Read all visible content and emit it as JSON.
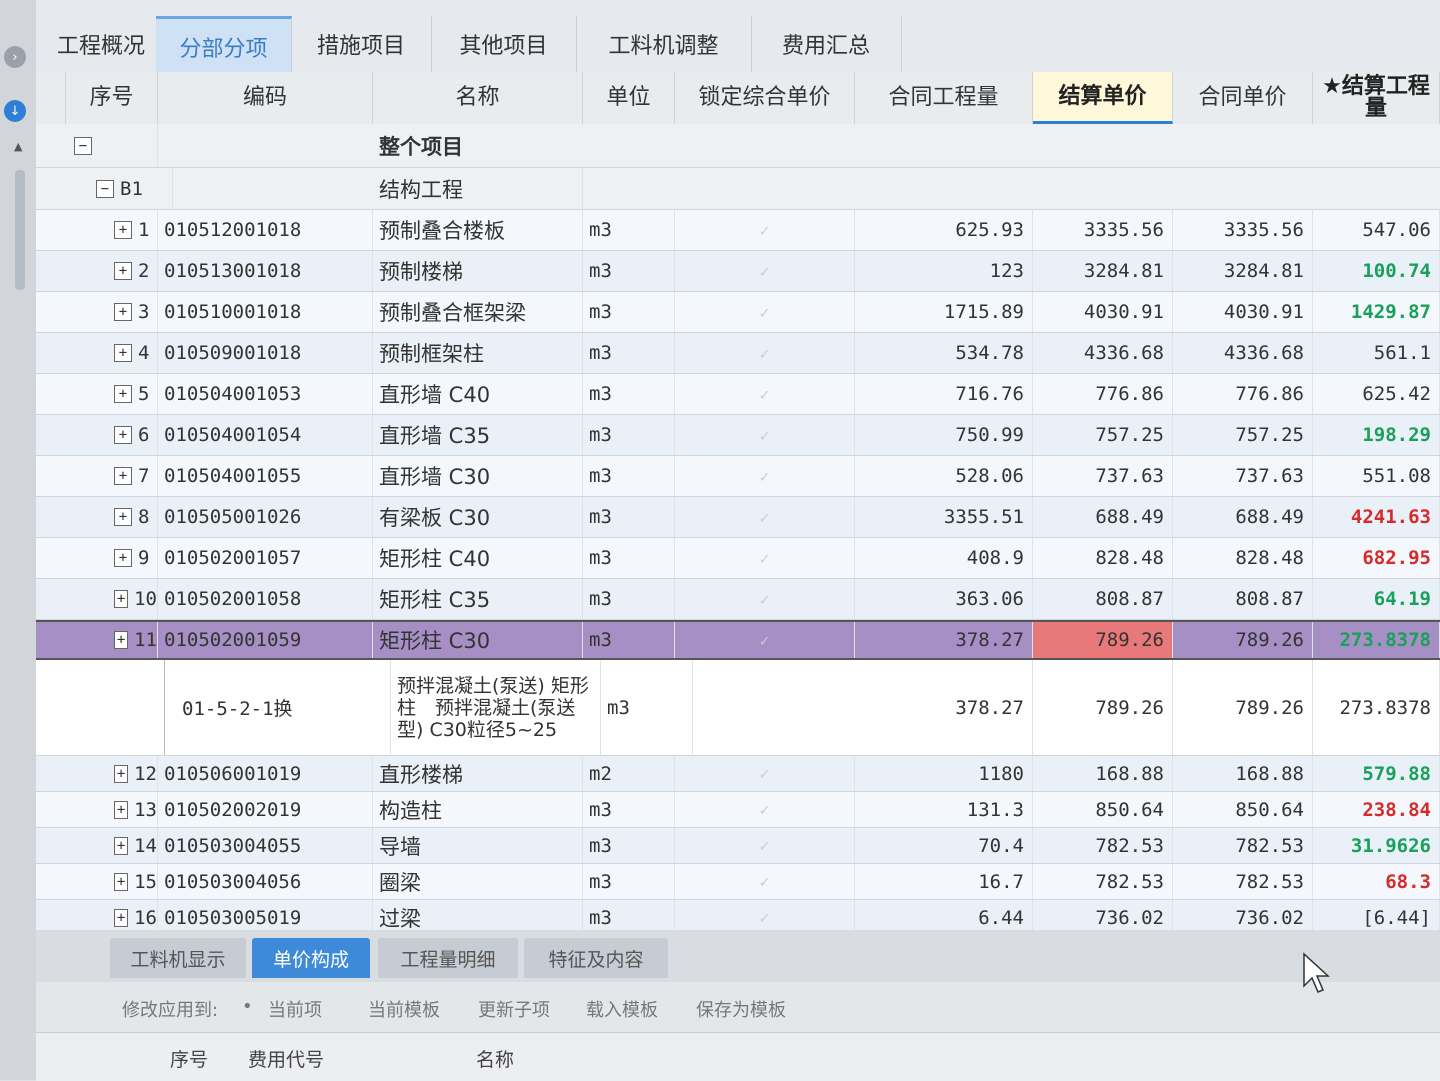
{
  "top_tabs": [
    "工程概况",
    "分部分项",
    "措施项目",
    "其他项目",
    "工料机调整",
    "费用汇总"
  ],
  "headers": {
    "seq": "序号",
    "code": "编码",
    "name": "名称",
    "unit": "单位",
    "locked": "锁定综合单价",
    "contract_qty": "合同工程量",
    "settle_price": "结算单价",
    "contract_price": "合同单价",
    "settle_qty": "★结算工程量"
  },
  "whole_project": "整个项目",
  "group": {
    "id": "B1",
    "name": "结构工程"
  },
  "rows": [
    {
      "seq": "1",
      "code": "010512001018",
      "name": "预制叠合楼板",
      "unit": "m3",
      "contract_qty": "625.93",
      "settle_price": "3335.56",
      "contract_price": "3335.56",
      "settle_qty": "547.06",
      "qty_style": "plain"
    },
    {
      "seq": "2",
      "code": "010513001018",
      "name": "预制楼梯",
      "unit": "m3",
      "contract_qty": "123",
      "settle_price": "3284.81",
      "contract_price": "3284.81",
      "settle_qty": "100.74",
      "qty_style": "green"
    },
    {
      "seq": "3",
      "code": "010510001018",
      "name": "预制叠合框架梁",
      "unit": "m3",
      "contract_qty": "1715.89",
      "settle_price": "4030.91",
      "contract_price": "4030.91",
      "settle_qty": "1429.87",
      "qty_style": "green"
    },
    {
      "seq": "4",
      "code": "010509001018",
      "name": "预制框架柱",
      "unit": "m3",
      "contract_qty": "534.78",
      "settle_price": "4336.68",
      "contract_price": "4336.68",
      "settle_qty": "561.1",
      "qty_style": "plain"
    },
    {
      "seq": "5",
      "code": "010504001053",
      "name": "直形墙 C40",
      "unit": "m3",
      "contract_qty": "716.76",
      "settle_price": "776.86",
      "contract_price": "776.86",
      "settle_qty": "625.42",
      "qty_style": "plain"
    },
    {
      "seq": "6",
      "code": "010504001054",
      "name": "直形墙 C35",
      "unit": "m3",
      "contract_qty": "750.99",
      "settle_price": "757.25",
      "contract_price": "757.25",
      "settle_qty": "198.29",
      "qty_style": "green"
    },
    {
      "seq": "7",
      "code": "010504001055",
      "name": "直形墙 C30",
      "unit": "m3",
      "contract_qty": "528.06",
      "settle_price": "737.63",
      "contract_price": "737.63",
      "settle_qty": "551.08",
      "qty_style": "plain"
    },
    {
      "seq": "8",
      "code": "010505001026",
      "name": "有梁板 C30",
      "unit": "m3",
      "contract_qty": "3355.51",
      "settle_price": "688.49",
      "contract_price": "688.49",
      "settle_qty": "4241.63",
      "qty_style": "red"
    },
    {
      "seq": "9",
      "code": "010502001057",
      "name": "矩形柱 C40",
      "unit": "m3",
      "contract_qty": "408.9",
      "settle_price": "828.48",
      "contract_price": "828.48",
      "settle_qty": "682.95",
      "qty_style": "red"
    },
    {
      "seq": "10",
      "code": "010502001058",
      "name": "矩形柱 C35",
      "unit": "m3",
      "contract_qty": "363.06",
      "settle_price": "808.87",
      "contract_price": "808.87",
      "settle_qty": "64.19",
      "qty_style": "green"
    },
    {
      "seq": "11",
      "code": "010502001059",
      "name": "矩形柱 C30",
      "unit": "m3",
      "contract_qty": "378.27",
      "settle_price": "789.26",
      "contract_price": "789.26",
      "settle_qty": "273.8378",
      "qty_style": "green"
    }
  ],
  "sub_row": {
    "code": "01-5-2-1换",
    "name": "预拌混凝土(泵送) 矩形柱　预拌混凝土(泵送型) C30粒径5~25",
    "unit": "m3",
    "contract_qty": "378.27",
    "settle_price": "789.26",
    "contract_price": "789.26",
    "settle_qty": "273.8378"
  },
  "rows_after": [
    {
      "seq": "12",
      "code": "010506001019",
      "name": "直形楼梯",
      "unit": "m2",
      "contract_qty": "1180",
      "settle_price": "168.88",
      "contract_price": "168.88",
      "settle_qty": "579.88",
      "qty_style": "green"
    },
    {
      "seq": "13",
      "code": "010502002019",
      "name": "构造柱",
      "unit": "m3",
      "contract_qty": "131.3",
      "settle_price": "850.64",
      "contract_price": "850.64",
      "settle_qty": "238.84",
      "qty_style": "red"
    },
    {
      "seq": "14",
      "code": "010503004055",
      "name": "导墙",
      "unit": "m3",
      "contract_qty": "70.4",
      "settle_price": "782.53",
      "contract_price": "782.53",
      "settle_qty": "31.9626",
      "qty_style": "green"
    },
    {
      "seq": "15",
      "code": "010503004056",
      "name": "圈梁",
      "unit": "m3",
      "contract_qty": "16.7",
      "settle_price": "782.53",
      "contract_price": "782.53",
      "settle_qty": "68.3",
      "qty_style": "red"
    },
    {
      "seq": "16",
      "code": "010503005019",
      "name": "过梁",
      "unit": "m3",
      "contract_qty": "6.44",
      "settle_price": "736.02",
      "contract_price": "736.02",
      "settle_qty": "[6.44]",
      "qty_style": "plain"
    }
  ],
  "bottom_tabs": [
    "工料机显示",
    "单价构成",
    "工程量明细",
    "特征及内容"
  ],
  "apply_bar": {
    "label": "修改应用到:",
    "current_item": "当前项",
    "current_template": "当前模板",
    "update_children": "更新子项",
    "load_template": "载入模板",
    "save_template": "保存为模板"
  },
  "lower_headers": {
    "seq": "序号",
    "fee_code": "费用代号",
    "name": "名称"
  },
  "colors": {
    "active_tab": "#3a7cc7",
    "selected_row": "#a58fc4",
    "green": "#19a05a",
    "red": "#d62b2b",
    "highlight": "#e9787a"
  }
}
